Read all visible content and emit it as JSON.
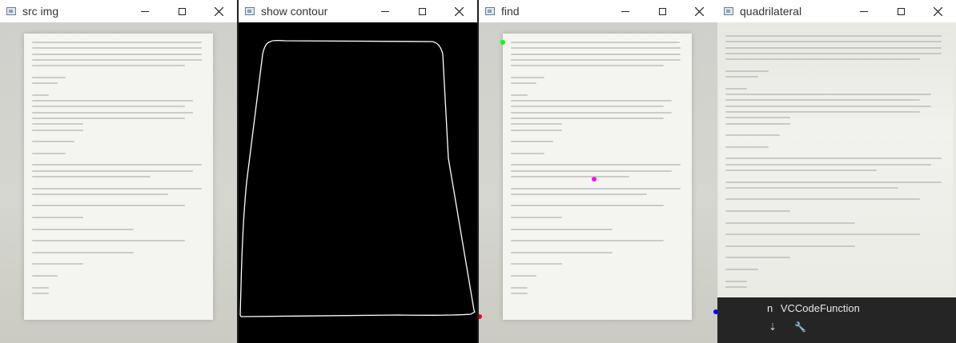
{
  "windows": [
    {
      "title": "src img"
    },
    {
      "title": "show contour"
    },
    {
      "title": "find"
    },
    {
      "title": "quadrilateral"
    }
  ],
  "vscode": {
    "function_label": "VCCodeFunction",
    "prefix": "n"
  },
  "colors": {
    "corner_top_left": "#00ff00",
    "corner_top_right": "#ffffff",
    "corner_bottom_left": "#ff0000",
    "corner_bottom_right": "#0000ff",
    "center_marker": "#ff00ff",
    "contour": "#ffffff"
  },
  "icons": [
    "app-icon",
    "minimize-icon",
    "maximize-icon",
    "close-icon",
    "sort-icon",
    "wrench-icon"
  ]
}
